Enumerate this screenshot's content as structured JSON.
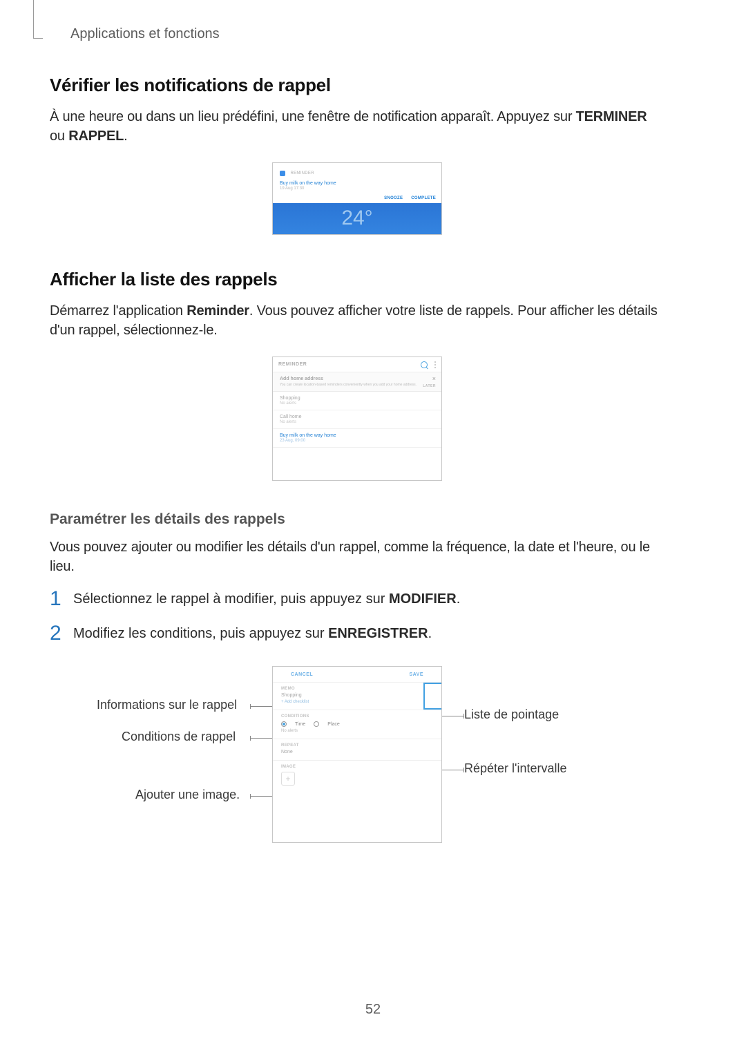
{
  "breadcrumb": "Applications et fonctions",
  "section1": {
    "title": "Vérifier les notifications de rappel",
    "body_pre": "À une heure ou dans un lieu prédéfini, une fenêtre de notification apparaît. Appuyez sur ",
    "kw1": "TERMINER",
    "mid": " ou ",
    "kw2": "RAPPEL",
    "body_post": "."
  },
  "fig1": {
    "app": "REMINDER",
    "title": "Buy milk on the way home",
    "time": "19 Aug 17:30",
    "snooze": "SNOOZE",
    "complete": "COMPLETE",
    "temp": "24°"
  },
  "section2": {
    "title": "Afficher la liste des rappels",
    "body_pre": "Démarrez l'application ",
    "kw": "Reminder",
    "body_post": ". Vous pouvez afficher votre liste de rappels. Pour afficher les détails d'un rappel, sélectionnez-le."
  },
  "fig2": {
    "header": "REMINDER",
    "tip_title": "Add home address",
    "tip_body": "You can create location-based reminders conveniently when you add your home address.",
    "tip_later": "LATER",
    "items": [
      {
        "title": "Shopping",
        "sub": "No alerts"
      },
      {
        "title": "Call home",
        "sub": "No alerts"
      },
      {
        "title": "Buy milk on the way home",
        "sub": "23 Aug, 09:00",
        "blue": true
      }
    ]
  },
  "section3": {
    "title": "Paramétrer les détails des rappels",
    "body": "Vous pouvez ajouter ou modifier les détails d'un rappel, comme la fréquence, la date et l'heure, ou le lieu."
  },
  "steps": {
    "n1": "1",
    "s1_pre": "Sélectionnez le rappel à modifier, puis appuyez sur ",
    "s1_kw": "MODIFIER",
    "s1_post": ".",
    "n2": "2",
    "s2_pre": "Modifiez les conditions, puis appuyez sur ",
    "s2_kw": "ENREGISTRER",
    "s2_post": "."
  },
  "fig3": {
    "cancel": "CANCEL",
    "save": "SAVE",
    "memo_lbl": "MEMO",
    "memo_val": "Shopping",
    "memo_sub": "+ Add checklist",
    "cond_lbl": "CONDITIONS",
    "cond_time": "Time",
    "cond_place": "Place",
    "cond_sub": "No alerts",
    "repeat_lbl": "REPEAT",
    "repeat_val": "None",
    "image_lbl": "IMAGE"
  },
  "callouts": {
    "c_left1": "Informations sur le rappel",
    "c_left2": "Conditions de rappel",
    "c_left3": "Ajouter une image.",
    "c_right1": "Liste de pointage",
    "c_right2": "Répéter l'intervalle"
  },
  "page_number": "52"
}
